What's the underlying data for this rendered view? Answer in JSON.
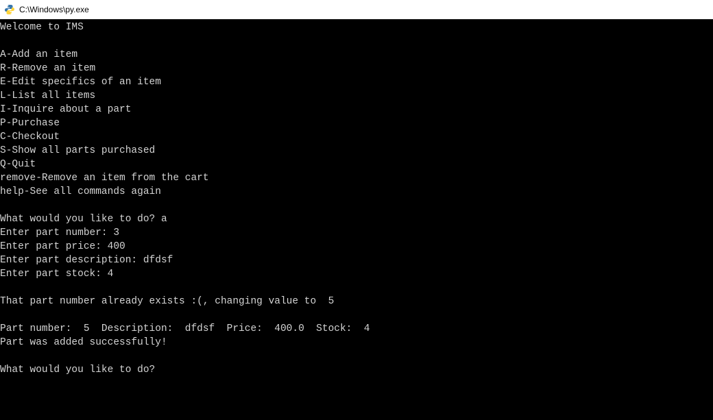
{
  "titlebar": {
    "path": "C:\\Windows\\py.exe"
  },
  "terminal": {
    "lines": [
      "Welcome to IMS",
      "",
      "A-Add an item",
      "R-Remove an item",
      "E-Edit specifics of an item",
      "L-List all items",
      "I-Inquire about a part",
      "P-Purchase",
      "C-Checkout",
      "S-Show all parts purchased",
      "Q-Quit",
      "remove-Remove an item from the cart",
      "help-See all commands again",
      "",
      "What would you like to do? a",
      "Enter part number: 3",
      "Enter part price: 400",
      "Enter part description: dfdsf",
      "Enter part stock: 4",
      "",
      "That part number already exists :(, changing value to  5",
      "",
      "Part number:  5  Description:  dfdsf  Price:  400.0  Stock:  4",
      "Part was added successfully!",
      "",
      "What would you like to do?"
    ]
  }
}
